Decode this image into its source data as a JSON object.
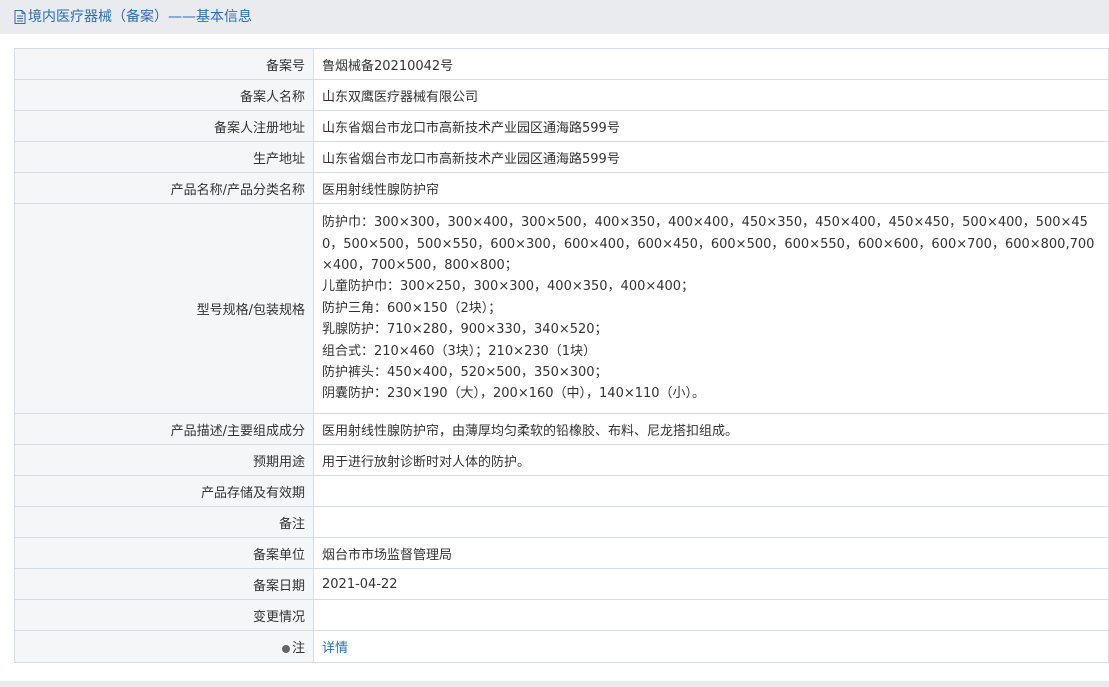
{
  "header": {
    "title": "境内医疗器械（备案）——基本信息",
    "icon": "document-icon"
  },
  "colors": {
    "title": "#2a6db5",
    "topbar_bg": "#e9ebee",
    "label_bg": "#f5f6f8",
    "border": "#d6dce3",
    "link": "#2a6db5"
  },
  "rows": [
    {
      "label": "备案号",
      "value": "鲁烟械备20210042号"
    },
    {
      "label": "备案人名称",
      "value": "山东双鹰医疗器械有限公司"
    },
    {
      "label": "备案人注册地址",
      "value": "山东省烟台市龙口市高新技术产业园区通海路599号"
    },
    {
      "label": "生产地址",
      "value": "山东省烟台市龙口市高新技术产业园区通海路599号"
    },
    {
      "label": "产品名称/产品分类名称",
      "value": "医用射线性腺防护帘"
    },
    {
      "label": "型号规格/包装规格",
      "lines": [
        "防护巾：300×300，300×400，300×500，400×350，400×400，450×350，450×400，450×450，500×400，500×450，500×500，500×550，600×300，600×400，600×450，600×500，600×550，600×600，600×700，600×800,700×400，700×500，800×800；",
        "儿童防护巾：300×250，300×300，400×350，400×400；",
        "防护三角：600×150（2块）；",
        "乳腺防护：710×280，900×330，340×520；",
        "组合式：210×460（3块）；210×230（1块）",
        "防护裤头：450×400，520×500，350×300；",
        "阴囊防护：230×190（大），200×160（中），140×110（小）。"
      ]
    },
    {
      "label": "产品描述/主要组成成分",
      "value": "医用射线性腺防护帘，由薄厚均匀柔软的铅橡胶、布料、尼龙搭扣组成。"
    },
    {
      "label": "预期用途",
      "value": "用于进行放射诊断时对人体的防护。"
    },
    {
      "label": "产品存储及有效期",
      "value": ""
    },
    {
      "label": "备注",
      "value": ""
    },
    {
      "label": "备案单位",
      "value": "烟台市市场监督管理局"
    },
    {
      "label": "备案日期",
      "value": "2021-04-22"
    },
    {
      "label": "变更情况",
      "value": ""
    },
    {
      "label": "注",
      "value": "详情",
      "icon": "info-dot-icon"
    }
  ]
}
